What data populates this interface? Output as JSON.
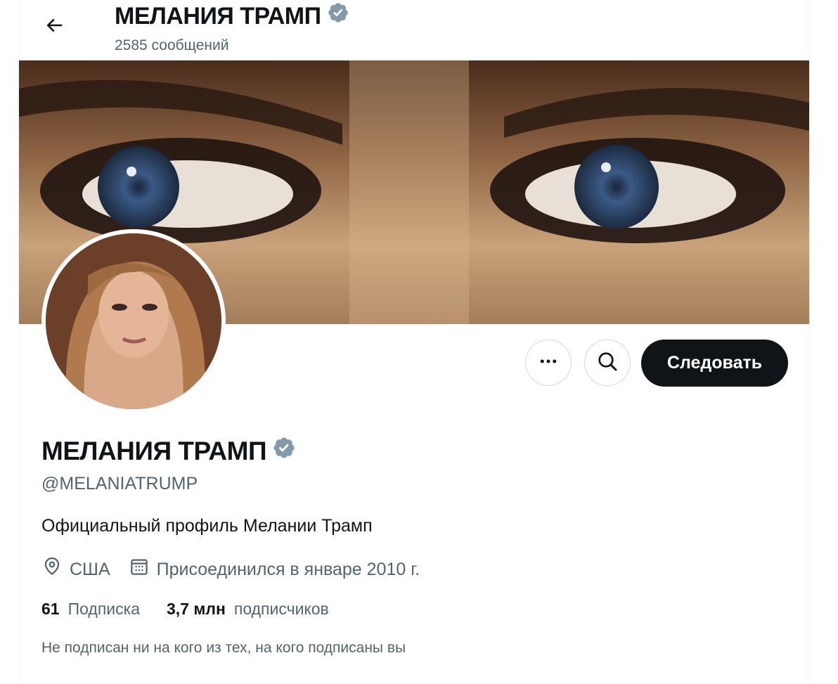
{
  "header": {
    "name": "МЕЛАНИЯ ТРАМП",
    "posts_count": "2585 сообщений"
  },
  "profile": {
    "name": "МЕЛАНИЯ ТРАМП",
    "handle": "@MELANIATRUMP",
    "bio": "Официальный профиль Мелании Трамп",
    "location": "США",
    "joined": "Присоединился в январе 2010 г.",
    "following_count": "61",
    "following_label": "Подписка",
    "followers_count": "3,7 млн",
    "followers_label": "подписчиков",
    "mutual_note": "Не подписан ни на кого из тех, на кого подписаны вы"
  },
  "actions": {
    "follow_label": "Следовать"
  },
  "icons": {
    "back": "arrow-left-icon",
    "verified": "verified-badge-icon",
    "more": "more-horizontal-icon",
    "search": "search-icon",
    "location": "location-pin-icon",
    "calendar": "calendar-icon"
  },
  "colors": {
    "verified_badge": "#829aab",
    "follow_bg": "#0f1419",
    "secondary_text": "#536471",
    "primary_text": "#0f1419"
  }
}
